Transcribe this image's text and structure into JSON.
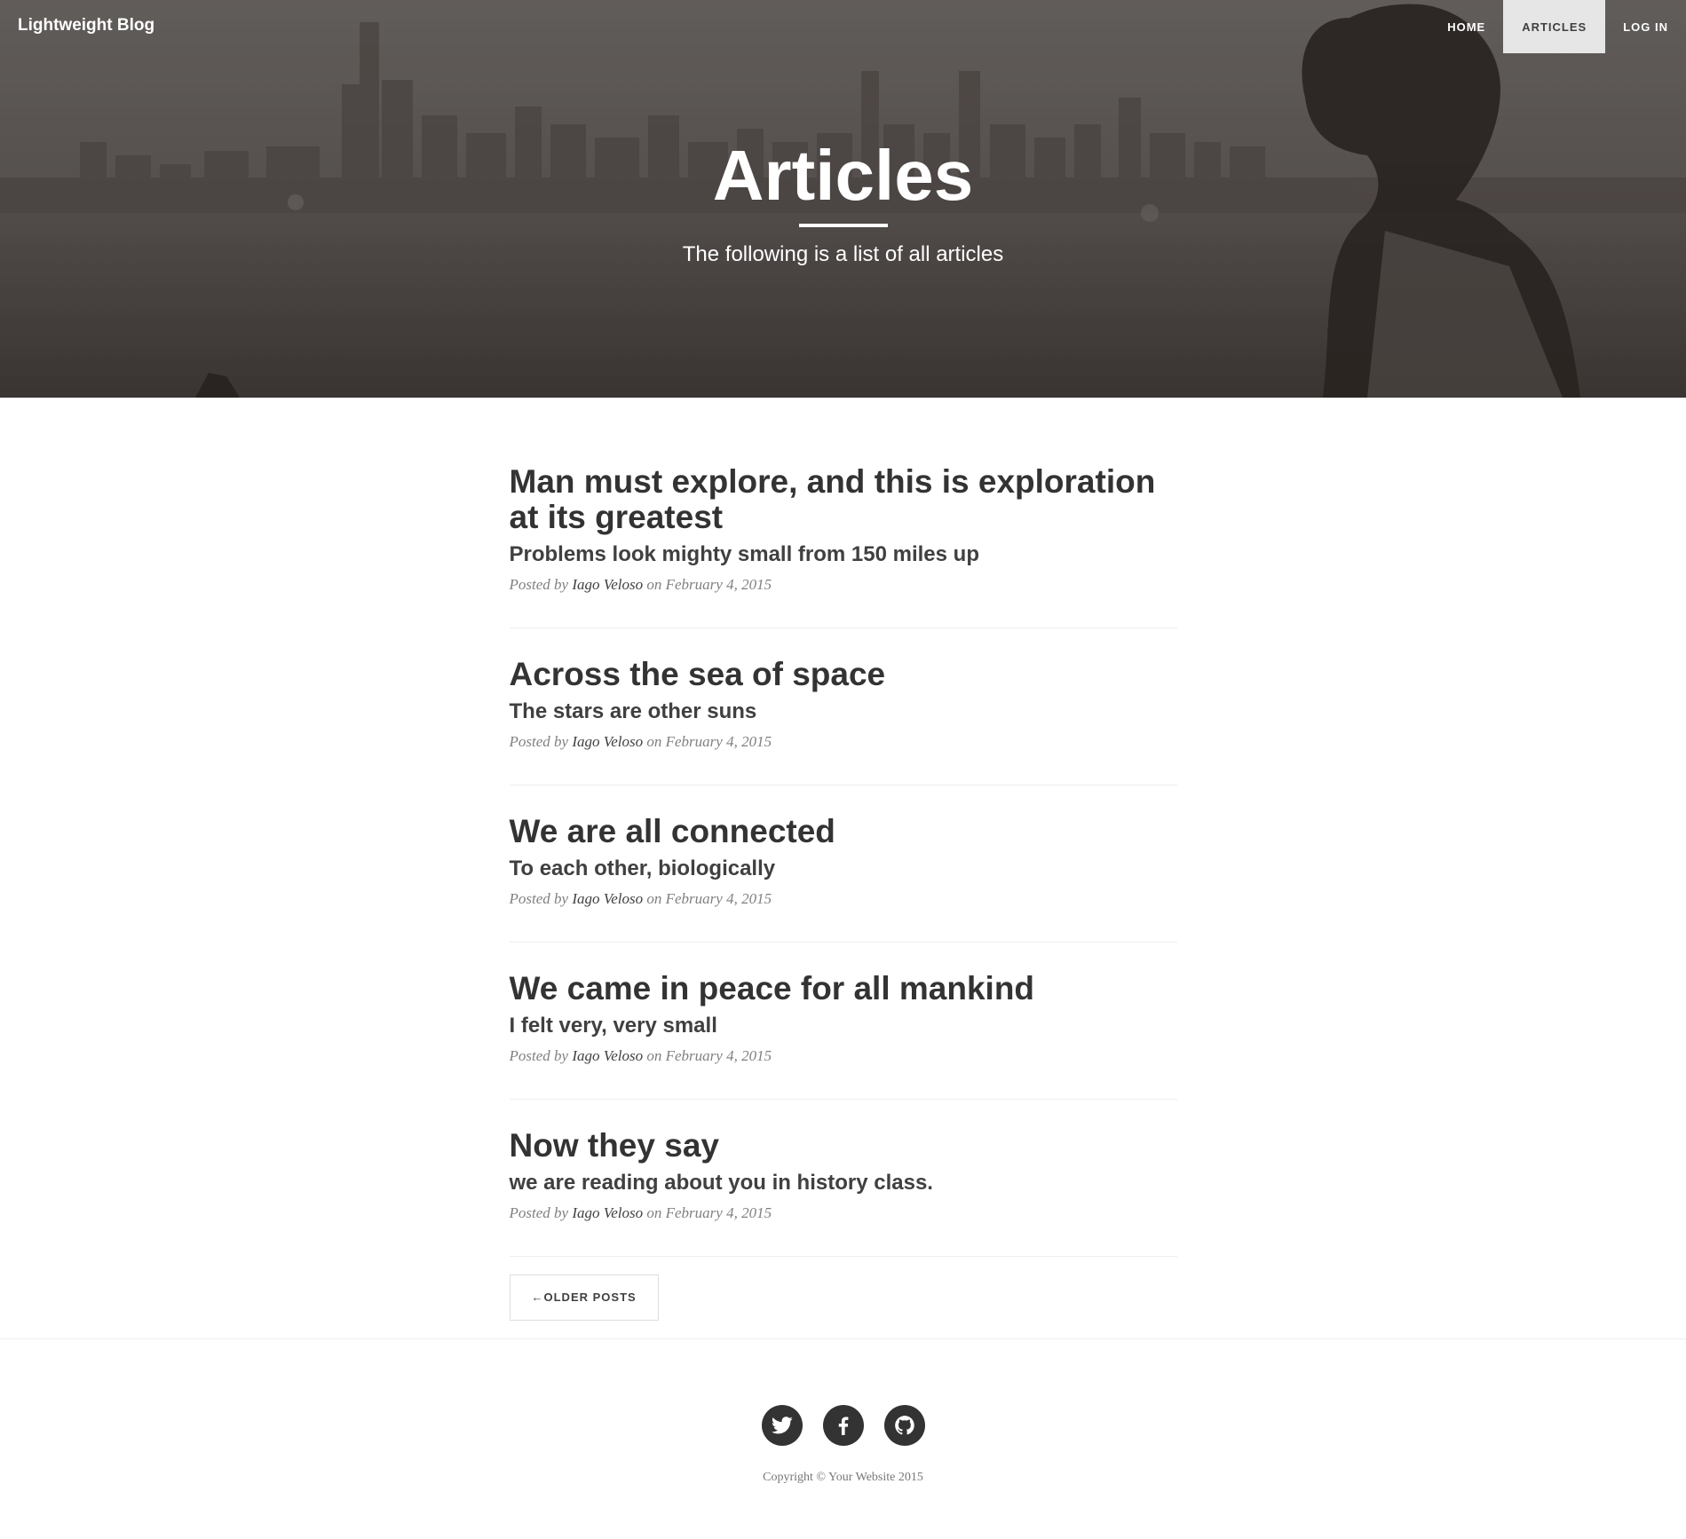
{
  "header": {
    "brand": "Lightweight Blog",
    "nav": [
      {
        "label": "HOME",
        "active": false
      },
      {
        "label": "ARTICLES",
        "active": true
      },
      {
        "label": "LOG IN",
        "active": false
      }
    ],
    "title": "Articles",
    "subtitle": "The following is a list of all articles"
  },
  "posts": [
    {
      "title": "Man must explore, and this is exploration at its greatest",
      "subtitle": "Problems look mighty small from 150 miles up",
      "posted_by": "Posted by",
      "author": "Iago Veloso",
      "date": "on February 4, 2015"
    },
    {
      "title": "Across the sea of space",
      "subtitle": "The stars are other suns",
      "posted_by": "Posted by",
      "author": "Iago Veloso",
      "date": "on February 4, 2015"
    },
    {
      "title": "We are all connected",
      "subtitle": "To each other, biologically",
      "posted_by": "Posted by",
      "author": "Iago Veloso",
      "date": "on February 4, 2015"
    },
    {
      "title": "We came in peace for all mankind",
      "subtitle": "I felt very, very small",
      "posted_by": "Posted by",
      "author": "Iago Veloso",
      "date": "on February 4, 2015"
    },
    {
      "title": "Now they say",
      "subtitle": "we are reading about you in history class.",
      "posted_by": "Posted by",
      "author": "Iago Veloso",
      "date": "on February 4, 2015"
    }
  ],
  "pager": {
    "older_label": "←OLDER POSTS"
  },
  "footer": {
    "social": [
      "twitter-icon",
      "facebook-icon",
      "github-icon"
    ],
    "copyright": "Copyright © Your Website 2015"
  },
  "colors": {
    "text": "#404040",
    "title": "#333333",
    "meta": "#808080",
    "nav_active_bg": "#e6e6e6",
    "social_bg": "#333333"
  }
}
